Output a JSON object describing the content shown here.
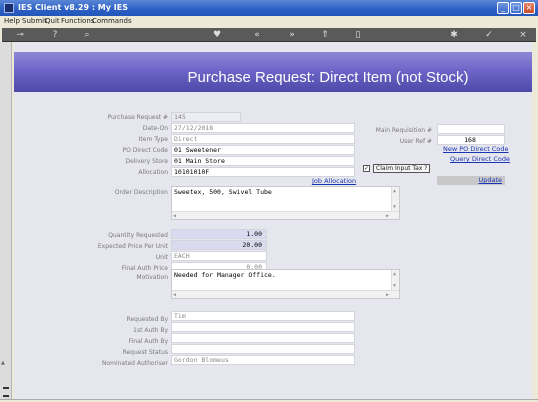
{
  "window": {
    "title": "IES Client v8.29 : My IES"
  },
  "menu": [
    "Help",
    "Submit",
    "Quit",
    "Functions",
    "Commands"
  ],
  "toolbar_icons": [
    "power-icon",
    "help-icon",
    "search-icon",
    "heart-icon",
    "refresh-icon",
    "back-icon",
    "forward-icon",
    "export-icon",
    "doc-icon",
    "settings-icon",
    "ok-icon",
    "close-icon"
  ],
  "page": {
    "heading": "Purchase Request: Direct Item (not Stock)"
  },
  "form": {
    "purchase_request_label": "Purchase Request #",
    "purchase_request_value": "145",
    "date_on_label": "Date-On",
    "date_on_value": "27/12/2018",
    "item_type_label": "Item Type",
    "item_type_value": "Direct",
    "po_direct_code_label": "PO Direct Code",
    "po_direct_code_value": "01 Sweetener",
    "delivery_store_label": "Delivery Store",
    "delivery_store_value": "01 Main Store",
    "allocation_label": "Allocation",
    "allocation_value": "10101010F",
    "job_allocation_link": "Job Allocation",
    "main_requisition_label": "Main Requisition #",
    "main_requisition_value": "",
    "user_ref_label": "User Ref #",
    "user_ref_value": "168",
    "new_po_direct_code_link": "New PO Direct Code",
    "query_direct_code_link": "Query Direct Code",
    "claim_input_tax_label": "Claim Input Tax ?",
    "claim_input_tax_checked": "✓",
    "update_link": "Update",
    "order_description_label": "Order Description",
    "order_description_value": "Sweetex, 500, Swivel Tube",
    "quantity_requested_label": "Quantity Requested",
    "quantity_requested_value": "1.00",
    "expected_price_label": "Expected Price Per Unit",
    "expected_price_value": "20.00",
    "unit_label": "Unit",
    "unit_value": "EACH",
    "final_auth_price_label": "Final Auth Price",
    "final_auth_price_value": "0.00",
    "motivation_label": "Motivation",
    "motivation_value": "Needed for Manager Office.",
    "requested_by_label": "Requested By",
    "requested_by_value": "Tim",
    "first_auth_by_label": "1st Auth By",
    "first_auth_by_value": "",
    "final_auth_by_label": "Final Auth By",
    "final_auth_by_value": "",
    "request_status_label": "Request Status",
    "request_status_value": "",
    "nominated_authoriser_label": "Nominated Authoriser",
    "nominated_authoriser_value": "Gordon Blomeus"
  }
}
